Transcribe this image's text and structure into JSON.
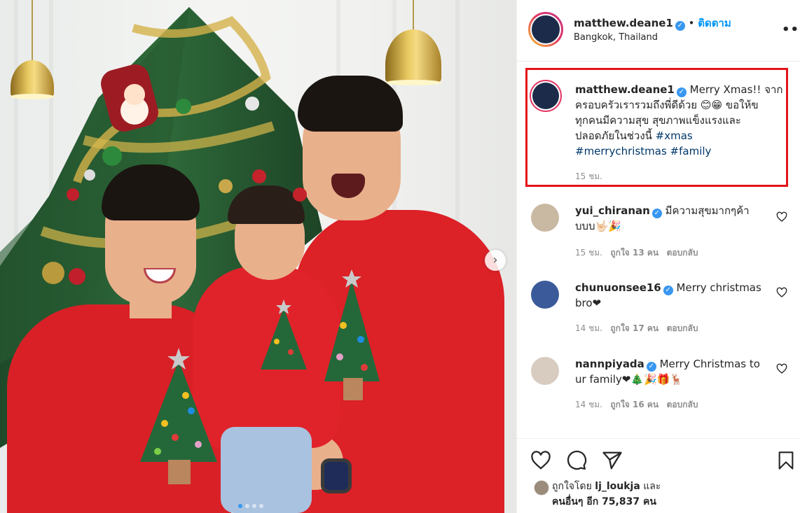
{
  "post": {
    "username": "matthew.deane1",
    "follow_label": "ติดตาม",
    "location": "Bangkok, Thailand",
    "more_label": "•••"
  },
  "caption": {
    "username": "matthew.deane1",
    "line1_text": " Merry Xmas!! จาก",
    "line2_text": "ครอบครัวเรารวมถึงพี่ดีด้วย 😊😁 ขอให้ข",
    "line3_text": "ทุกคนมีความสุข สุขภาพแข็งแรงและ",
    "line4_text": "ปลอดภัยในช่วงนี้ ",
    "hashtag_xmas": "#xmas",
    "hashtag_merrychristmas": "#merrychristmas",
    "hashtag_family": "#family",
    "time": "15 ชม."
  },
  "comments": [
    {
      "username": "yui_chiranan",
      "text_line1": " มีความสุขมากๆค้า",
      "text_line2": "บบบ🤟🏻🎉",
      "time": "15 ชม.",
      "likes": "ถูกใจ 13 คน",
      "reply": "ตอบกลับ"
    },
    {
      "username": "chunuonsee16",
      "text_line1": " Merry christmas",
      "text_line2": "bro❤",
      "time": "14 ชม.",
      "likes": "ถูกใจ 17 คน",
      "reply": "ตอบกลับ"
    },
    {
      "username": "nannpiyada",
      "text_line1": " Merry Christmas to",
      "text_line2": "ur family❤🎄🎉🎁🦌",
      "time": "14 ชม.",
      "likes": "ถูกใจ 16 คน",
      "reply": "ตอบกลับ"
    }
  ],
  "likes": {
    "prefix": "ถูกใจโดย ",
    "user": "lj_loukja",
    "suffix": " และ",
    "others": "คนอื่นๆ อีก 75,837 คน"
  },
  "icons": {
    "like": "heart-icon",
    "comment": "comment-icon",
    "share": "share-icon",
    "save": "bookmark-icon",
    "next": "chevron-right-icon",
    "verified": "verified-badge-icon"
  },
  "colors": {
    "accent_blue": "#0095f6",
    "verified_blue": "#3897f0",
    "highlight_red": "#e3131b",
    "sweater_red": "#d92027"
  }
}
